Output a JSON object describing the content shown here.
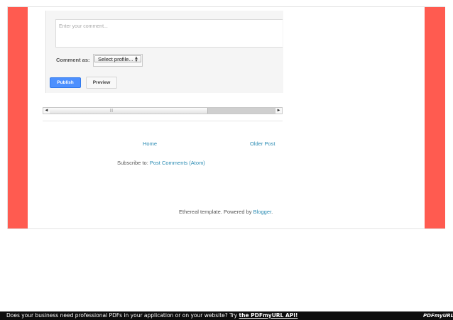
{
  "comment_form": {
    "placeholder": "Enter your comment...",
    "comment_as_label": "Comment as:",
    "profile_select_value": "Select profile...",
    "publish_label": "Publish",
    "preview_label": "Preview"
  },
  "scrollbar": {
    "left_arrow": "◄",
    "right_arrow": "►",
    "grip": "|||"
  },
  "navigation": {
    "home_label": "Home",
    "older_post_label": "Older Post"
  },
  "subscribe": {
    "prefix": "Subscribe to:",
    "link_label": "Post Comments (Atom)"
  },
  "attribution": {
    "text": "Ethereal template. Powered by",
    "link_label": "Blogger",
    "suffix": "."
  },
  "footer_banner": {
    "text": "Does your business need professional PDFs in your application or on your website? Try",
    "link_label": "the PDFmyURL API!",
    "logo_text": "PDFmyURL"
  },
  "colors": {
    "side_accent": "#ff5b50",
    "link": "#2a8bb3",
    "publish_button": "#4d90fe"
  }
}
